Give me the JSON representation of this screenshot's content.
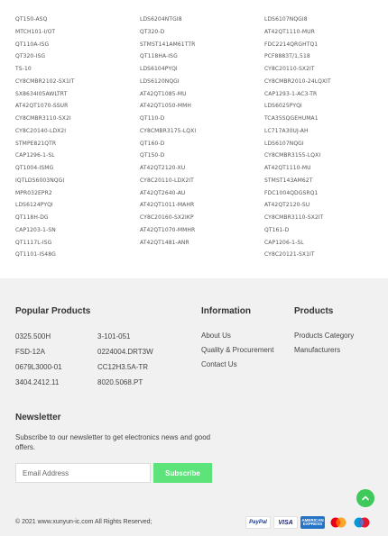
{
  "part_links": {
    "col0": [
      "QT150-ASQ",
      "MTCH101-I/OT",
      "QT110A-ISG",
      "QT320-ISG",
      "TS-10",
      "CY8CMBR2102-SX1IT",
      "SX8634I05AWLTRT",
      "AT42QT1070-SSUR",
      "CY8CMBR3110-SX2I",
      "CY8C20140-LDX2I",
      "STMPE821QTR",
      "CAP1296-1-SL",
      "QT1004-ISMG",
      "IQTLDS6003NQGI",
      "MPR032EPR2",
      "LDS6124PYQI",
      "QT118H-DG",
      "CAP1203-1-SN",
      "QT1117L-ISG",
      "QT1101-IS48G"
    ],
    "col1": [
      "LDS6204NTGI8",
      "QT320-D",
      "STMST141AM61TTR",
      "QT118HA-ISG",
      "LDS6104PYQI",
      "LDS6120NQGI",
      "AT42QT1085-MU",
      "AT42QT1050-MMH",
      "QT110-D",
      "CY8CMBR3175-LQXI",
      "QT160-D",
      "QT150-D",
      "AT42QT2120-XU",
      "CY8C20110-LDX2IT",
      "AT42QT2640-AU",
      "AT42QT1011-MAHR",
      "CY8C20160-SX2IKP",
      "AT42QT1070-MMHR",
      "AT42QT1481-ANR"
    ],
    "col2": [
      "LDS6107NQGI8",
      "AT42QT1110-MUR",
      "FDC2214QRGHTQ1",
      "PCF8883T/1,518",
      "CY8C20110-SX2IT",
      "CY8CMBR2010-24LQXIT",
      "CAP1293-1-AC3-TR",
      "LDS6025PYQI",
      "TCA35SQGEHUMA1",
      "LC717A30UJ-AH",
      "LDS6107NQGI",
      "CY8CMBR3155-LQXI",
      "AT42QT1110-MU",
      "STMST143AM62T",
      "FDC1004QDGSRQ1",
      "AT42QT2120-SU",
      "CY8CMBR3110-SX2IT",
      "QT161-D",
      "CAP1206-1-SL",
      "CY8C20121-SX1IT"
    ]
  },
  "footer": {
    "popular": {
      "heading": "Popular Products",
      "items": [
        "0325.500H",
        "3-101-051",
        "FSD-12A",
        "0224004.DRT3W",
        "0679L3000-01",
        "CC12H3.5A-TR",
        "3404.2412.11",
        "8020.5068.PT"
      ]
    },
    "information": {
      "heading": "Information",
      "links": [
        "About Us",
        "Quality & Procurement",
        "Contact Us"
      ]
    },
    "products": {
      "heading": "Products",
      "links": [
        "Products Category",
        "Manufacturers"
      ]
    },
    "newsletter": {
      "heading": "Newsletter",
      "text": "Subscribe to our newsletter to get electronics news and good offers.",
      "placeholder": "Email Address",
      "button": "Subscribe"
    },
    "copyright": "© 2021 www.xunyun-ic.com All Rights Reserved;",
    "payments": {
      "paypal": "PayPal",
      "visa": "VISA",
      "amex": "AMERICAN EXPRESS"
    },
    "colors": {
      "accent": "#5ce37a",
      "to_top": "#3fc95b",
      "footer_bg": "#f1f1f1"
    }
  }
}
